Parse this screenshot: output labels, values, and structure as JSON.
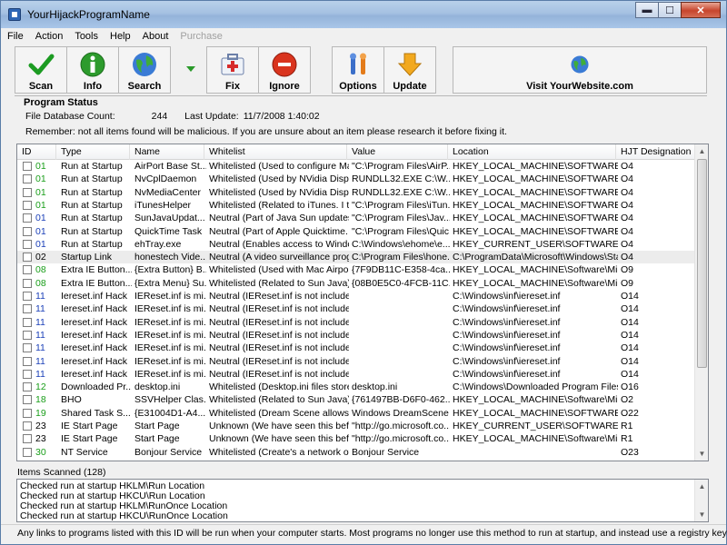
{
  "window": {
    "title": "YourHijackProgramName",
    "controls": {
      "minimize": "▬",
      "maximize": "☐",
      "close": "✕"
    }
  },
  "menu": [
    "File",
    "Action",
    "Tools",
    "Help",
    "About",
    "Purchase"
  ],
  "toolbar": {
    "scan": "Scan",
    "info": "Info",
    "search": "Search",
    "fix": "Fix",
    "ignore": "Ignore",
    "options": "Options",
    "update": "Update",
    "visit": "Visit YourWebsite.com"
  },
  "status": {
    "title": "Program Status",
    "db_label": "File Database Count:",
    "db_value": "244",
    "update_label": "Last Update:",
    "update_value": "11/7/2008 1:40:02",
    "remember": "Remember: not all items found will be malicious.  If you are unsure about an item please research it before fixing it."
  },
  "columns": [
    "ID",
    "Type",
    "Name",
    "Whitelist",
    "Value",
    "Location",
    "HJT Designation"
  ],
  "rows": [
    [
      "01",
      "Run at Startup",
      "AirPort Base St...",
      "Whitelisted (Used to configure Mac...",
      "\"C:\\Program Files\\AirP...",
      "HKEY_LOCAL_MACHINE\\SOFTWARE\\...",
      "O4"
    ],
    [
      "01",
      "Run at Startup",
      "NvCplDaemon",
      "Whitelisted (Used by NVidia Displa...",
      "RUNDLL32.EXE C:\\W...",
      "HKEY_LOCAL_MACHINE\\SOFTWARE\\...",
      "O4"
    ],
    [
      "01",
      "Run at Startup",
      "NvMediaCenter",
      "Whitelisted (Used by NVidia Displa...",
      "RUNDLL32.EXE C:\\W...",
      "HKEY_LOCAL_MACHINE\\SOFTWARE\\...",
      "O4"
    ],
    [
      "01",
      "Run at Startup",
      "iTunesHelper",
      "Whitelisted (Related to iTunes.  I tu...",
      "\"C:\\Program Files\\iTun...",
      "HKEY_LOCAL_MACHINE\\SOFTWARE\\...",
      "O4"
    ],
    [
      "01",
      "Run at Startup",
      "SunJavaUpdat...",
      "Neutral (Part of Java Sun updates. ...",
      "\"C:\\Program Files\\Jav...",
      "HKEY_LOCAL_MACHINE\\SOFTWARE\\...",
      "O4"
    ],
    [
      "01",
      "Run at Startup",
      "QuickTime Task",
      "Neutral (Part of Apple Quicktime.  It...",
      "\"C:\\Program Files\\Quic...",
      "HKEY_LOCAL_MACHINE\\SOFTWARE\\...",
      "O4"
    ],
    [
      "01",
      "Run at Startup",
      "ehTray.exe",
      "Neutral (Enables access to Windo...",
      "C:\\Windows\\ehome\\e...",
      "HKEY_CURRENT_USER\\SOFTWARE\\...",
      "O4"
    ],
    [
      "02",
      "Startup Link",
      "honestech Vide...",
      "Neutral (A video surveillance progr...",
      "C:\\Program Files\\hone...",
      "C:\\ProgramData\\Microsoft\\Windows\\Star...",
      "O4"
    ],
    [
      "08",
      "Extra IE Button...",
      "{Extra Button} B...",
      "Whitelisted (Used with Mac Airport ...",
      "{7F9DB11C-E358-4ca...",
      "HKEY_LOCAL_MACHINE\\Software\\Micr...",
      "O9"
    ],
    [
      "08",
      "Extra IE Button...",
      "{Extra Menu} Su...",
      "Whitelisted (Related to Sun Java)",
      "{08B0E5C0-4FCB-11C...",
      "HKEY_LOCAL_MACHINE\\Software\\Micr...",
      "O9"
    ],
    [
      "11",
      "Iereset.inf Hack",
      "IEReset.inf is mi...",
      "Neutral (IEReset.inf is not included ...",
      "",
      "C:\\Windows\\inf\\iereset.inf",
      "O14"
    ],
    [
      "11",
      "Iereset.inf Hack",
      "IEReset.inf is mi...",
      "Neutral (IEReset.inf is not included ...",
      "",
      "C:\\Windows\\inf\\iereset.inf",
      "O14"
    ],
    [
      "11",
      "Iereset.inf Hack",
      "IEReset.inf is mi...",
      "Neutral (IEReset.inf is not included ...",
      "",
      "C:\\Windows\\inf\\iereset.inf",
      "O14"
    ],
    [
      "11",
      "Iereset.inf Hack",
      "IEReset.inf is mi...",
      "Neutral (IEReset.inf is not included ...",
      "",
      "C:\\Windows\\inf\\iereset.inf",
      "O14"
    ],
    [
      "11",
      "Iereset.inf Hack",
      "IEReset.inf is mi...",
      "Neutral (IEReset.inf is not included ...",
      "",
      "C:\\Windows\\inf\\iereset.inf",
      "O14"
    ],
    [
      "11",
      "Iereset.inf Hack",
      "IEReset.inf is mi...",
      "Neutral (IEReset.inf is not included ...",
      "",
      "C:\\Windows\\inf\\iereset.inf",
      "O14"
    ],
    [
      "11",
      "Iereset.inf Hack",
      "IEReset.inf is mi...",
      "Neutral (IEReset.inf is not included ...",
      "",
      "C:\\Windows\\inf\\iereset.inf",
      "O14"
    ],
    [
      "12",
      "Downloaded Pr...",
      "desktop.ini",
      "Whitelisted (Desktop.ini files store i...",
      "desktop.ini",
      "C:\\Windows\\Downloaded Program Files",
      "O16"
    ],
    [
      "18",
      "BHO",
      "SSVHelper Clas...",
      "Whitelisted (Related to Sun Java)",
      "{761497BB-D6F0-462...",
      "HKEY_LOCAL_MACHINE\\Software\\Micr...",
      "O2"
    ],
    [
      "19",
      "Shared Task S...",
      "{E31004D1-A4...",
      "Whitelisted (Dream Scene allows y...",
      "Windows DreamScene",
      "HKEY_LOCAL_MACHINE\\SOFTWARE\\...",
      "O22"
    ],
    [
      "23",
      "IE Start Page",
      "Start Page",
      "Unknown (We have seen this befo...",
      "\"http://go.microsoft.co...",
      "HKEY_CURRENT_USER\\SOFTWARE\\Micr...",
      "R1"
    ],
    [
      "23",
      "IE Start Page",
      "Start Page",
      "Unknown (We have seen this befo...",
      "\"http://go.microsoft.co...",
      "HKEY_LOCAL_MACHINE\\Software\\Micr...",
      "R1"
    ],
    [
      "30",
      "NT Service",
      "Bonjour Service",
      "Whitelisted (Create's a network of ...",
      "Bonjour Service",
      "",
      "O23"
    ]
  ],
  "items_scanned": "Items Scanned (128)",
  "log": [
    "Checked run at startup HKLM\\Run Location",
    "Checked run at startup HKCU\\Run Location",
    "Checked run at startup HKLM\\RunOnce Location",
    "Checked run at startup HKCU\\RunOnce Location"
  ],
  "statusbar": "Any links to programs listed with this ID will be run when your computer starts.  Most programs no longer use this method to run at startup, and instead use a registry key.",
  "colors": {
    "id_green": "#1a9e1a",
    "id_blue": "#1a3fb8",
    "selected_row": "#ececec"
  },
  "icons": {
    "scan": "green-checkmark-icon",
    "info": "info-icon",
    "search": "globe-icon",
    "fix": "first-aid-kit-icon",
    "ignore": "red-stop-icon",
    "options": "tools-icon",
    "update": "down-arrow-icon",
    "visit": "globe-icon"
  }
}
